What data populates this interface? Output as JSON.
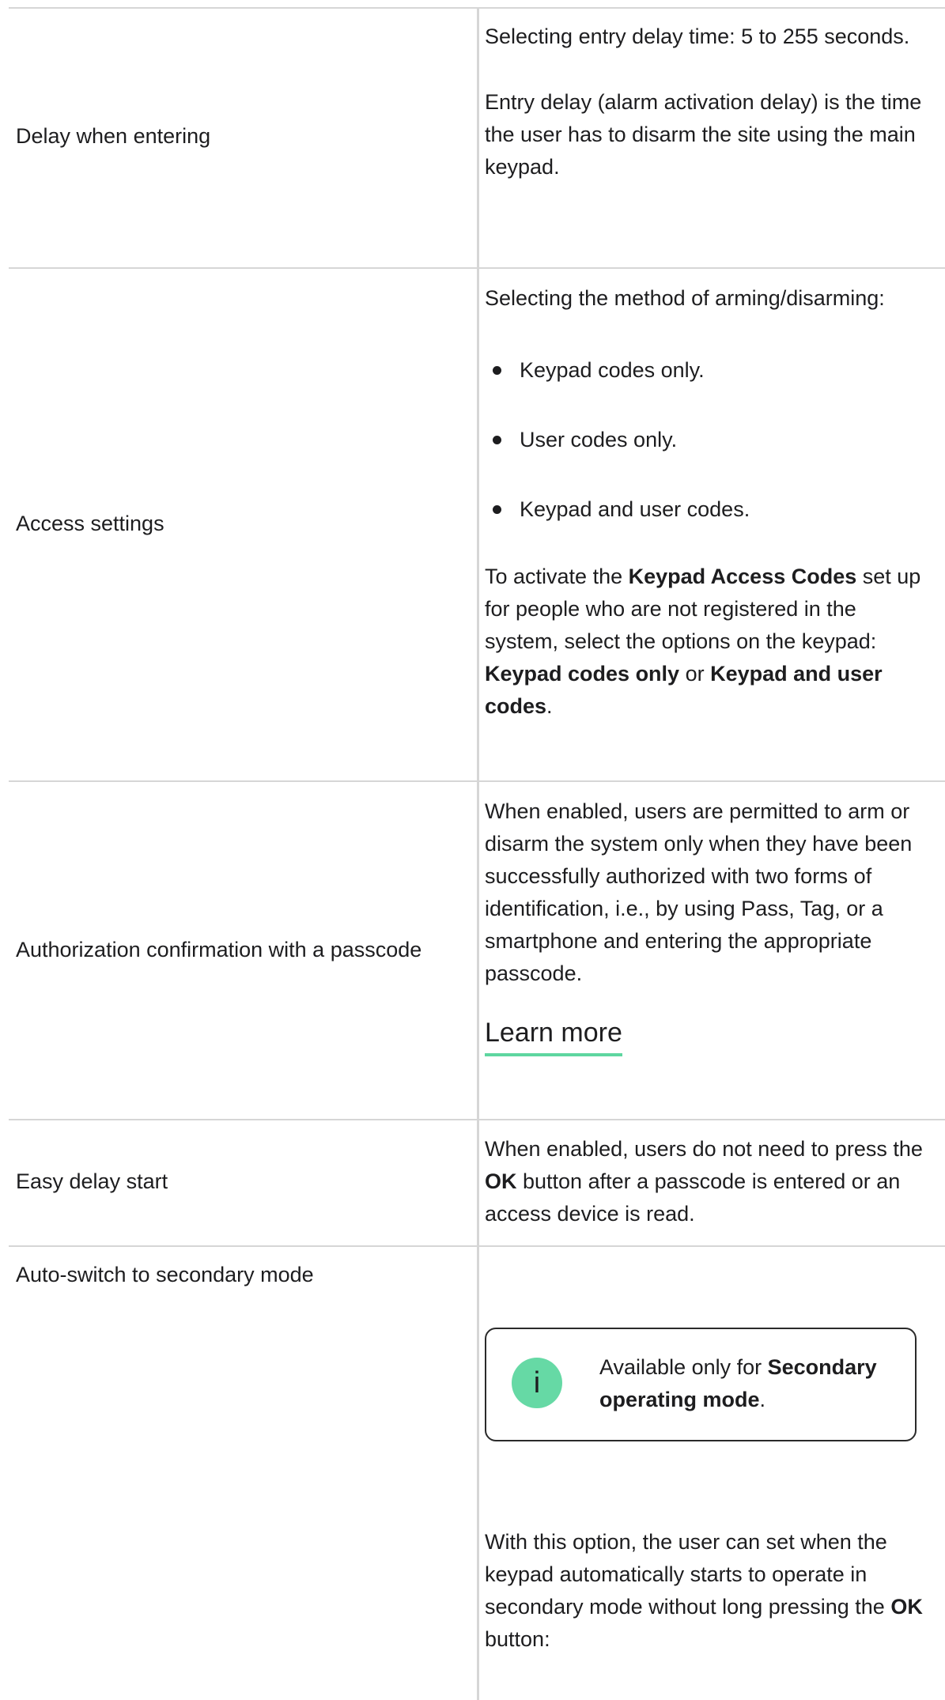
{
  "rows": [
    {
      "label": "Delay when entering",
      "paragraphs": [
        "Selecting entry delay time: 5 to 255 seconds.",
        "Entry delay (alarm activation delay) is the time the user has to disarm the site using the main keypad."
      ]
    },
    {
      "label": "Access settings",
      "intro": "Selecting the method of arming/disarming:",
      "bullets": [
        "Keypad codes only.",
        "User codes only.",
        "Keypad and user codes."
      ],
      "note": {
        "t1": "To activate the ",
        "b1": "Keypad Access Codes",
        "t2": " set up for people who are not registered in the system, select the options on the keypad: ",
        "b2": "Keypad codes only",
        "t3": " or ",
        "b3": "Keypad and user codes",
        "t4": "."
      }
    },
    {
      "label": "Authorization confirmation with a passcode",
      "text": "When enabled, users are permitted to arm or disarm the system only when they have been successfully authorized with two forms of identification, i.e., by using Pass, Tag, or a smartphone and entering the appropriate passcode.",
      "link": "Learn more"
    },
    {
      "label": "Easy delay start",
      "t1": "When enabled, users do not need to press the ",
      "b1": "OK",
      "t2": " button after a passcode is entered or an access device is read."
    },
    {
      "label": "Auto-switch to secondary mode",
      "info": {
        "icon": "i",
        "t1": "Available only for ",
        "b1": "Secondary operating mode",
        "t2": "."
      },
      "text": {
        "t1": "With this option, the user can set when the keypad automatically starts to operate in secondary mode without long pressing the ",
        "b1": "OK",
        "t2": " button:"
      }
    }
  ]
}
